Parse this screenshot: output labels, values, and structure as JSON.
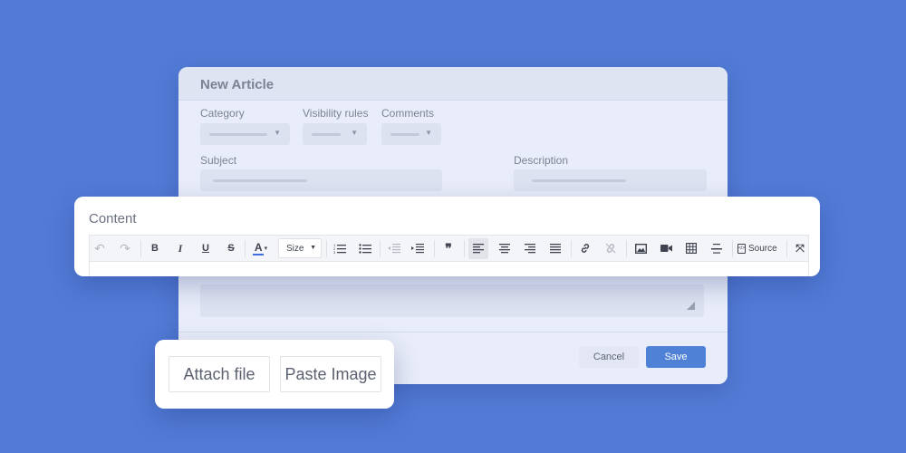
{
  "dialog": {
    "title": "New Article",
    "labels": {
      "category": "Category",
      "visibility": "Visibility rules",
      "comments": "Comments",
      "subject": "Subject",
      "description": "Description"
    },
    "buttons": {
      "cancel": "Cancel",
      "save": "Save"
    }
  },
  "editor": {
    "title": "Content",
    "toolbar": {
      "size_label": "Size",
      "source_label": "Source",
      "source_icon_glyph": "</>",
      "icons": [
        "undo-icon",
        "redo-icon",
        "bold-icon",
        "italic-icon",
        "underline-icon",
        "strikethrough-icon",
        "text-color-icon",
        "ordered-list-icon",
        "bullet-list-icon",
        "outdent-icon",
        "indent-icon",
        "blockquote-icon",
        "align-left-icon",
        "align-center-icon",
        "align-right-icon",
        "align-justify-icon",
        "link-icon",
        "unlink-icon",
        "image-icon",
        "video-icon",
        "table-icon",
        "horizontal-rule-icon",
        "source-icon",
        "fullscreen-icon"
      ],
      "glyphs": {
        "undo": "↶",
        "redo": "↷",
        "bold": "B",
        "italic": "I",
        "underline": "U",
        "strike": "S",
        "color": "A",
        "quote": "❞",
        "unlink": "⦸",
        "fullscreen": "⤧",
        "caret": "▾",
        "caret_small": "▼"
      },
      "active": "align-left"
    }
  },
  "attach": {
    "attach_file": "Attach file",
    "paste_image": "Paste Image"
  },
  "colors": {
    "background": "#527bd6",
    "accent": "#4f81d6",
    "text_color_swatch": "#3d6fdc"
  }
}
